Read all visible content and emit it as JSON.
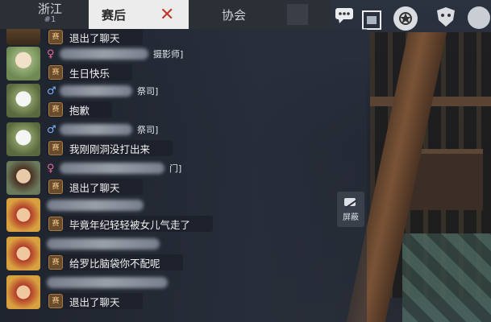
{
  "tabs": {
    "region": "浙江",
    "region_sub": "#1",
    "active": "赛后",
    "association": "协会"
  },
  "side_action": {
    "label": "屏蔽"
  },
  "colors": {
    "panel": "#232834",
    "active_tab": "#ececec",
    "tag_bg": "#6a4b2c",
    "female": "#e56a9a",
    "male": "#7fb0ff"
  },
  "messages": [
    {
      "avatar": "avatar-brown",
      "gender": "",
      "title": "",
      "tag": "赛",
      "text": "退出了聊天",
      "offset": -22
    },
    {
      "avatar": "avatar-silver-green",
      "gender": "♀",
      "title": "摄影师]",
      "tag": "赛",
      "text": "生日快乐"
    },
    {
      "avatar": "avatar-clown",
      "gender": "♂",
      "title": "祭司]",
      "tag": "赛",
      "text": "抱歉"
    },
    {
      "avatar": "avatar-clown",
      "gender": "♂",
      "title": "祭司]",
      "tag": "赛",
      "text": "我刚刚洞没打出来"
    },
    {
      "avatar": "avatar-lady",
      "gender": "♀",
      "title": "门]",
      "tag": "赛",
      "text": "退出了聊天"
    },
    {
      "avatar": "avatar-red",
      "gender": "",
      "title": "",
      "tag": "赛",
      "text": "毕竟年纪轻轻被女儿气走了"
    },
    {
      "avatar": "avatar-red",
      "gender": "",
      "title": "",
      "tag": "赛",
      "text": "给罗比脑袋你不配呢"
    },
    {
      "avatar": "avatar-red",
      "gender": "",
      "title": "",
      "tag": "赛",
      "text": "退出了聊天"
    }
  ],
  "icons": [
    "chat-bubble-icon",
    "photo-frame-icon",
    "badge-icon",
    "shield-mask-icon",
    "settings-circle-icon"
  ]
}
